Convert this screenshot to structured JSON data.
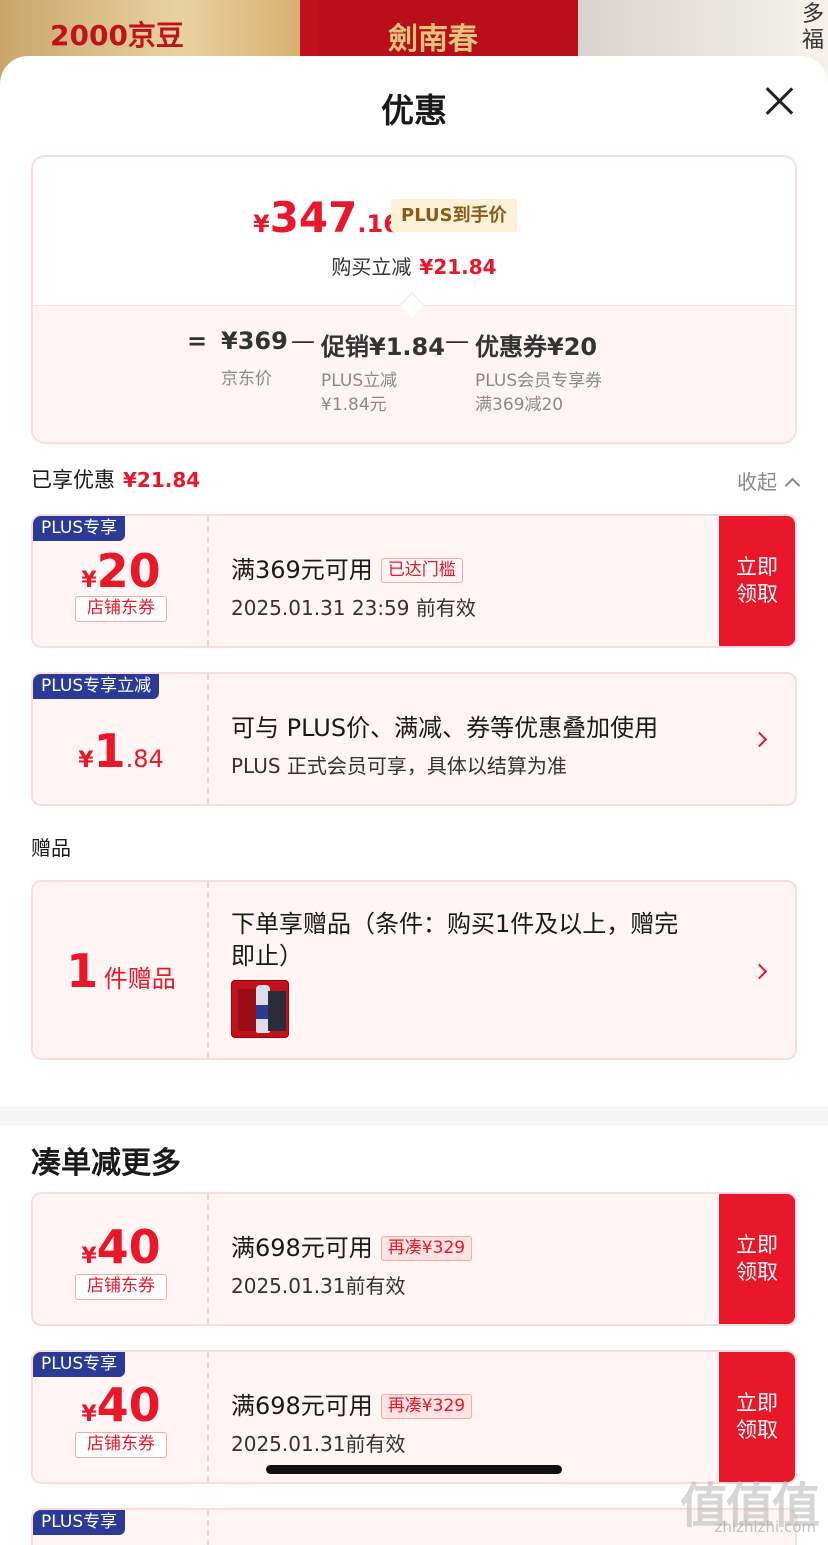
{
  "banner": {
    "left_text": "2000京豆",
    "mid_text": "劍南春",
    "right_text": "多福"
  },
  "header": {
    "title": "优惠"
  },
  "summary": {
    "currency": "¥",
    "price_int": "347",
    "price_dec": ".16",
    "plus_tag": "PLUS到手价",
    "reduce_label": "购买立减",
    "reduce_value": "¥21.84",
    "equals": "=",
    "jd_price": "¥369",
    "minus1": "—",
    "promo": "促销¥1.84",
    "minus2": "—",
    "coupon": "优惠券¥20",
    "jd_price_label": "京东价",
    "promo_label_1": "PLUS立减",
    "promo_label_2": "¥1.84元",
    "coupon_label_1": "PLUS会员专享券",
    "coupon_label_2": "满369减20"
  },
  "enjoyed": {
    "label": "已享优惠",
    "value": "¥21.84",
    "collapse": "收起"
  },
  "coupons": [
    {
      "badge": "PLUS专享",
      "currency": "¥",
      "amount": "20",
      "type": "店铺东券",
      "main": "满369元可用",
      "tag": "已达门槛",
      "sub": "2025.01.31 23:59 前有效",
      "action": "立即领取"
    },
    {
      "badge": "PLUS专享立减",
      "currency": "¥",
      "amount": "1",
      "amount_dec": ".84",
      "main": "可与 PLUS价、满减、券等优惠叠加使用",
      "sub": "PLUS 正式会员可享，具体以结算为准"
    }
  ],
  "gift": {
    "section_label": "赠品",
    "count": "1",
    "unit": "件赠品",
    "line1": "下单享赠品（条件：购买1件及以上，赠完",
    "line2": "即止）"
  },
  "more": {
    "title": "凑单减更多",
    "coupons": [
      {
        "currency": "¥",
        "amount": "40",
        "type": "店铺东券",
        "main": "满698元可用",
        "tag": "再凑¥329",
        "sub": "2025.01.31前有效",
        "action": "立即领取"
      },
      {
        "badge": "PLUS专享",
        "currency": "¥",
        "amount": "40",
        "type": "店铺东券",
        "main": "满698元可用",
        "tag": "再凑¥329",
        "sub": "2025.01.31前有效",
        "action": "立即领取"
      },
      {
        "badge": "PLUS专享"
      }
    ]
  },
  "watermark": {
    "big": "值值值",
    "small": "zhizhizhi.com"
  },
  "colors": {
    "accent": "#e8172a",
    "plus_badge": "#2a3a95",
    "card_bg": "#fff5f5"
  }
}
